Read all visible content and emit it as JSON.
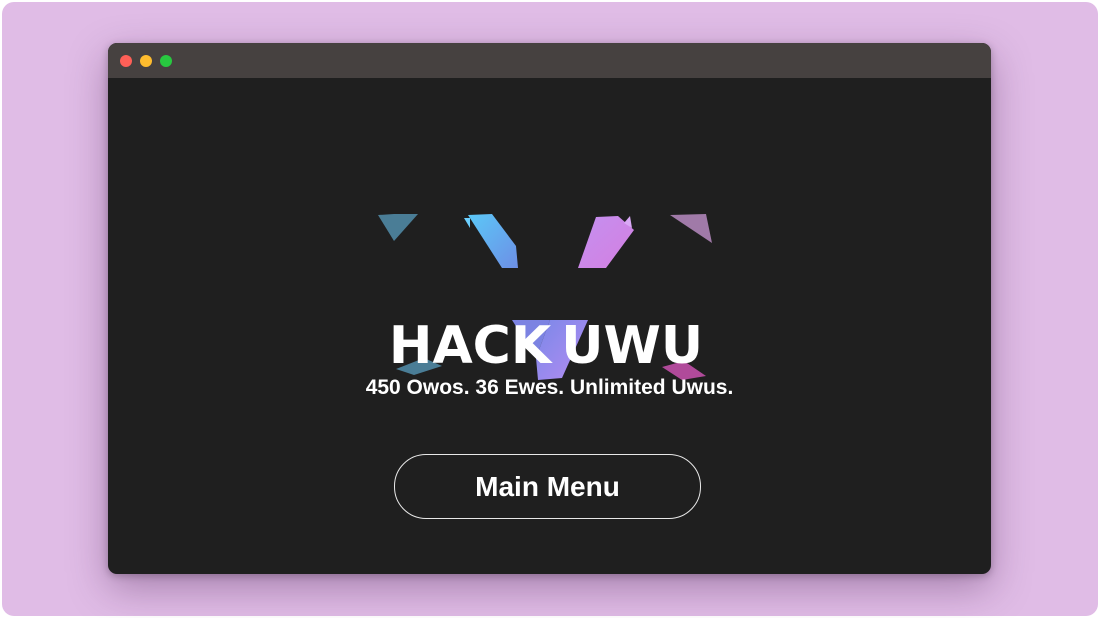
{
  "logo": {
    "brand_text": "HACK UWU",
    "colors": {
      "blue": "#5bc3f4",
      "purple": "#c88cf0",
      "violet": "#8e7ff0",
      "teal": "#4a7d96",
      "mauve": "#a07aa8",
      "magenta": "#b04a9a"
    }
  },
  "tagline": "450 Owos. 36 Ewes. Unlimited Uwus.",
  "main_menu_button": {
    "label": "Main Menu"
  },
  "window_controls": {
    "close": "close-dot",
    "minimize": "minimize-dot",
    "maximize": "maximize-dot"
  },
  "colors": {
    "backdrop": "#e0bce6",
    "window_bg": "#1f1f1f",
    "titlebar_bg": "#464140"
  }
}
